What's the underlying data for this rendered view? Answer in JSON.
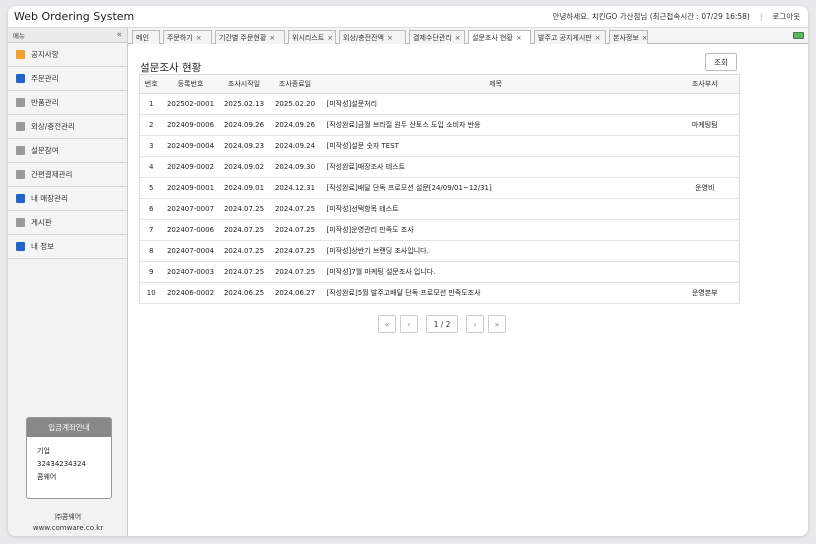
{
  "app": {
    "title": "Web Ordering System",
    "greeting": "안녕하세요. 치킨GO 가산점님 (최근접속시간 : 07/29 16:58)",
    "separator": "|",
    "logout": "로그아웃"
  },
  "sidebar": {
    "header": "메뉴",
    "collapse_glyph": "«",
    "items": [
      {
        "label": "공지사항",
        "color": "#f0a030"
      },
      {
        "label": "주문관리",
        "color": "#2266cc"
      },
      {
        "label": "반품관리",
        "color": "#999999"
      },
      {
        "label": "외상/충전관리",
        "color": "#999999"
      },
      {
        "label": "설문참여",
        "color": "#999999"
      },
      {
        "label": "간편결제관리",
        "color": "#999999"
      },
      {
        "label": "내 매장관리",
        "color": "#2266cc"
      },
      {
        "label": "게시판",
        "color": "#999999"
      },
      {
        "label": "내 정보",
        "color": "#2266cc"
      }
    ],
    "account_box": {
      "title": "입금계좌안내",
      "bank": "기업",
      "number": "32434234324",
      "holder": "콤웨어"
    },
    "company": {
      "name": "㈜콤웨어",
      "url": "www.comware.co.kr"
    }
  },
  "tabs": [
    {
      "label": "메인",
      "closable": false,
      "active": false
    },
    {
      "label": "주문하기",
      "closable": true,
      "active": false
    },
    {
      "label": "기간별 주문현황",
      "closable": true,
      "active": false
    },
    {
      "label": "위시리스트",
      "closable": true,
      "active": false
    },
    {
      "label": "외상/충전잔액",
      "closable": true,
      "active": false
    },
    {
      "label": "결제수단관리",
      "closable": true,
      "active": false
    },
    {
      "label": "설문조사 현황",
      "closable": true,
      "active": true
    },
    {
      "label": "발주고 공지게시판",
      "closable": true,
      "active": false
    },
    {
      "label": "본사정보",
      "closable": true,
      "active": false
    }
  ],
  "tab_close_glyph": "×",
  "status_color": "#5cb85c",
  "page": {
    "title": "설문조사 현황",
    "search_button": "조회"
  },
  "table": {
    "columns": [
      "번호",
      "등록번호",
      "조사시작일",
      "조사종료일",
      "제목",
      "조사부서"
    ],
    "rows": [
      [
        "1",
        "202502-0001",
        "2025.02.13",
        "2025.02.20",
        "[미작성]설문처리",
        ""
      ],
      [
        "2",
        "202409-0006",
        "2024.09.26",
        "2024.09.26",
        "[작성완료]금월 브라질 원두 산토스 도입 소비자 반응",
        "마케팅팀"
      ],
      [
        "3",
        "202409-0004",
        "2024.09.23",
        "2024.09.24",
        "[미작성]설문 숫자 TEST",
        ""
      ],
      [
        "4",
        "202409-0002",
        "2024.09.02",
        "2024.09.30",
        "[작성완료]매장조사 테스트",
        ""
      ],
      [
        "5",
        "202409-0001",
        "2024.09.01",
        "2024.12.31",
        "[작성완료]배달 단독 프로모션 설문[24/09/01~12/31]",
        "운영비"
      ],
      [
        "6",
        "202407-0007",
        "2024.07.25",
        "2024.07.25",
        "[미작성]선택항목 테스트",
        ""
      ],
      [
        "7",
        "202407-0006",
        "2024.07.25",
        "2024.07.25",
        "[미작성]운영관리 만족도 조사",
        ""
      ],
      [
        "8",
        "202407-0004",
        "2024.07.25",
        "2024.07.25",
        "[미작성]상반기 브랜딩 조사입니다.",
        ""
      ],
      [
        "9",
        "202407-0003",
        "2024.07.25",
        "2024.07.25",
        "[미작성]7월 마케팅 설문조사 입니다.",
        ""
      ],
      [
        "10",
        "202406-0002",
        "2024.06.25",
        "2024.06.27",
        "[작성완료]5월 발주고배달 단독 프로모션 만족도조사",
        "운영본부"
      ]
    ]
  },
  "pager": {
    "first": "«",
    "prev": "‹",
    "page": "1 / 2",
    "next": "›",
    "last": "»"
  }
}
